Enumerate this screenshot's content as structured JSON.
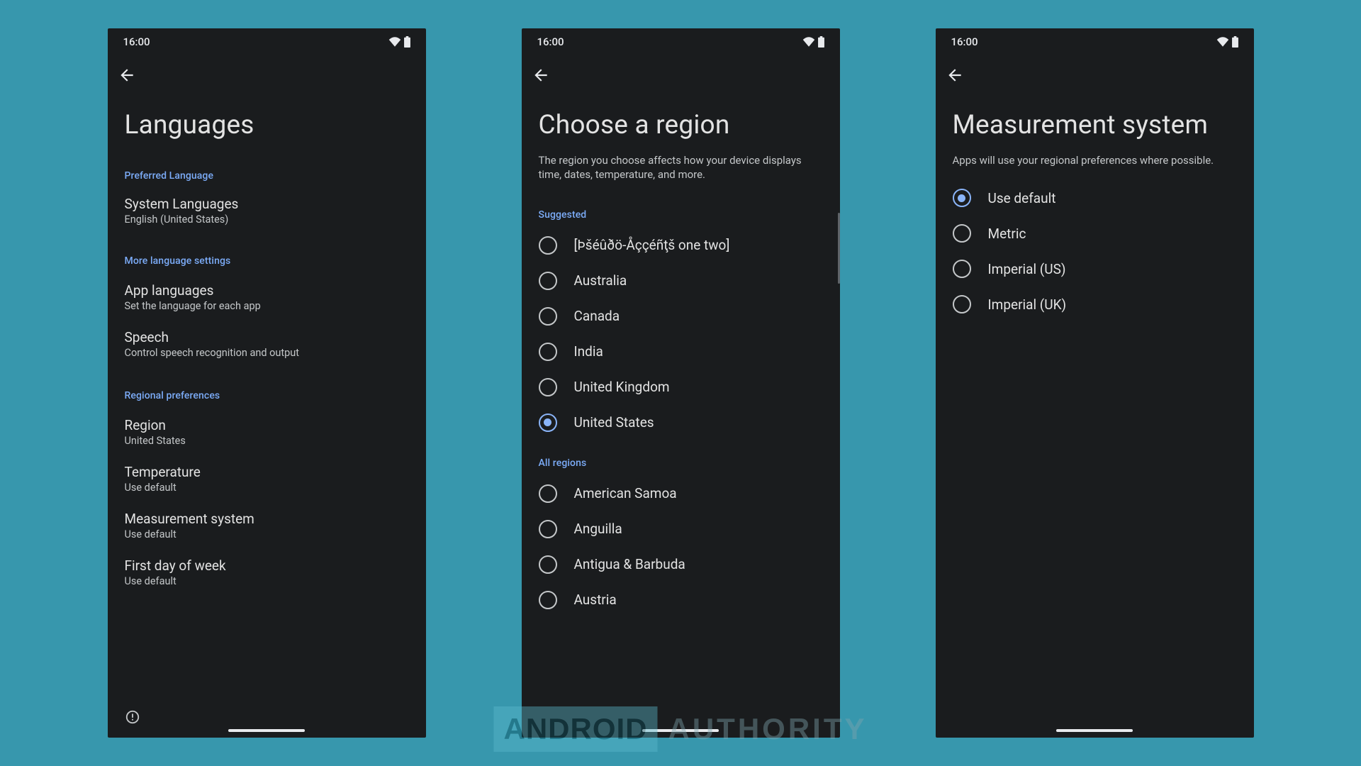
{
  "status": {
    "time": "16:00"
  },
  "watermark": {
    "badge": "ANDROID",
    "text": "AUTHORITY"
  },
  "screens": {
    "languages": {
      "title": "Languages",
      "sections": [
        {
          "header": "Preferred Language",
          "items": [
            {
              "title": "System Languages",
              "sub": "English (United States)"
            }
          ]
        },
        {
          "header": "More language settings",
          "items": [
            {
              "title": "App languages",
              "sub": "Set the language for each app"
            },
            {
              "title": "Speech",
              "sub": "Control speech recognition and output"
            }
          ]
        },
        {
          "header": "Regional preferences",
          "items": [
            {
              "title": "Region",
              "sub": "United States"
            },
            {
              "title": "Temperature",
              "sub": "Use default"
            },
            {
              "title": "Measurement system",
              "sub": "Use default"
            },
            {
              "title": "First day of week",
              "sub": "Use default"
            }
          ]
        }
      ]
    },
    "region": {
      "title": "Choose a region",
      "subtext": "The region you choose affects how your device displays time, dates, temperature, and more.",
      "suggested_header": "Suggested",
      "suggested": [
        {
          "label": "[Þšéûðö-Åççéñţš one two]",
          "selected": false
        },
        {
          "label": "Australia",
          "selected": false
        },
        {
          "label": "Canada",
          "selected": false
        },
        {
          "label": "India",
          "selected": false
        },
        {
          "label": "United Kingdom",
          "selected": false
        },
        {
          "label": "United States",
          "selected": true
        }
      ],
      "all_header": "All regions",
      "all": [
        {
          "label": "American Samoa"
        },
        {
          "label": "Anguilla"
        },
        {
          "label": "Antigua & Barbuda"
        },
        {
          "label": "Austria"
        }
      ]
    },
    "measurement": {
      "title": "Measurement system",
      "subtext": "Apps will use your regional preferences where possible.",
      "options": [
        {
          "label": "Use default",
          "selected": true
        },
        {
          "label": "Metric",
          "selected": false
        },
        {
          "label": "Imperial (US)",
          "selected": false
        },
        {
          "label": "Imperial (UK)",
          "selected": false
        }
      ]
    }
  }
}
